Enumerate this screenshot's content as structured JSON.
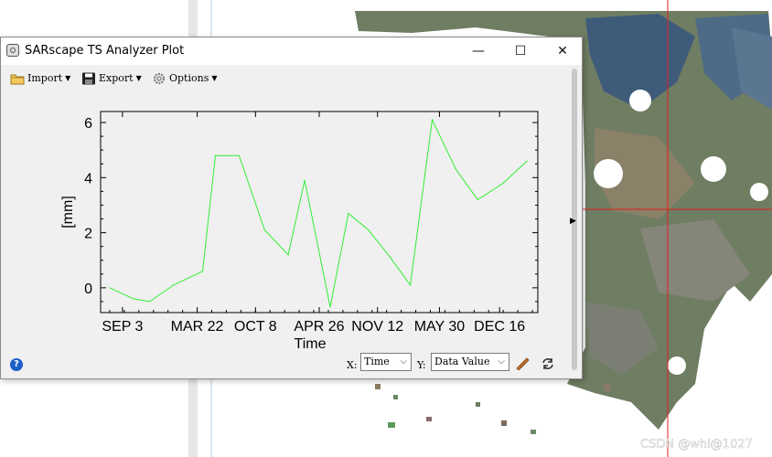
{
  "window": {
    "title": "SARscape TS Analyzer Plot",
    "minimize_glyph": "—",
    "maximize_glyph": "☐",
    "close_glyph": "✕"
  },
  "toolbar": {
    "import_label": "Import",
    "export_label": "Export",
    "options_label": "Options"
  },
  "bottom": {
    "help_glyph": "?",
    "x_label": "X:",
    "x_value": "Time",
    "y_label": "Y:",
    "y_value": "Data Value"
  },
  "background": {
    "watermark": "CSDN @whl@1027",
    "crosshair_color": "#e0201e"
  },
  "colors": {
    "line": "#33ee33",
    "plot_bg": "#f0f0f0",
    "axis": "#000000"
  },
  "chart_data": {
    "type": "line",
    "title": "",
    "xlabel": "Time",
    "ylabel": "[mm]",
    "ylim": [
      -0.9,
      6.4
    ],
    "yticks": [
      0,
      2,
      4,
      6
    ],
    "xlim": [
      0,
      24
    ],
    "xticks": [
      {
        "x": 1.2,
        "label": "SEP 3"
      },
      {
        "x": 5.3,
        "label": "MAR 22"
      },
      {
        "x": 8.5,
        "label": "OCT 8"
      },
      {
        "x": 12.0,
        "label": "APR 26"
      },
      {
        "x": 15.2,
        "label": "NOV 12"
      },
      {
        "x": 18.6,
        "label": "MAY 30"
      },
      {
        "x": 21.9,
        "label": "DEC 16"
      }
    ],
    "series": [
      {
        "values": [
          [
            0.5,
            0.0
          ],
          [
            1.8,
            -0.4
          ],
          [
            2.7,
            -0.5
          ],
          [
            4.0,
            0.1
          ],
          [
            5.6,
            0.6
          ],
          [
            6.3,
            4.8
          ],
          [
            7.6,
            4.8
          ],
          [
            9.0,
            2.1
          ],
          [
            10.3,
            1.2
          ],
          [
            11.2,
            3.9
          ],
          [
            12.6,
            -0.7
          ],
          [
            13.6,
            2.7
          ],
          [
            14.7,
            2.1
          ],
          [
            15.9,
            1.1
          ],
          [
            17.0,
            0.1
          ],
          [
            18.2,
            6.1
          ],
          [
            19.5,
            4.3
          ],
          [
            20.7,
            3.2
          ],
          [
            22.1,
            3.8
          ],
          [
            23.4,
            4.6
          ]
        ]
      }
    ]
  }
}
